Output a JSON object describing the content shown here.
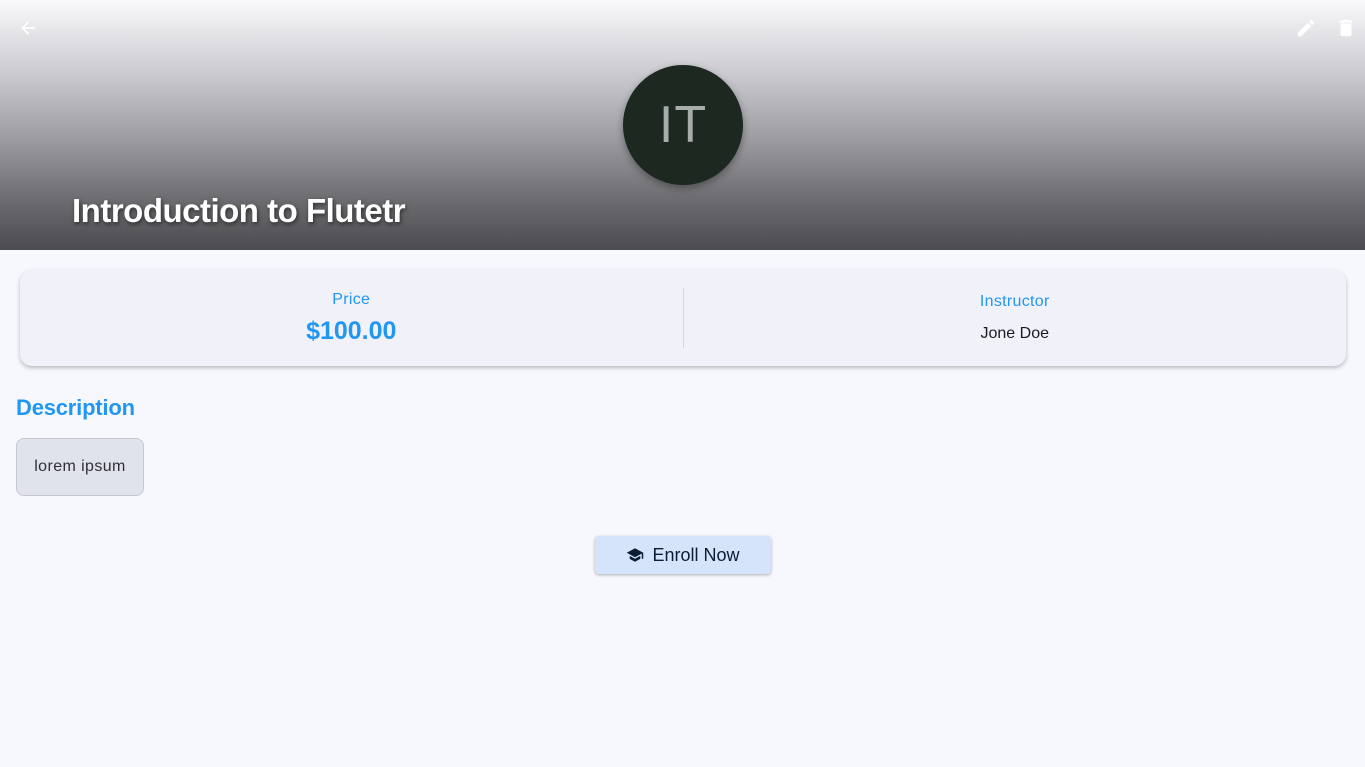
{
  "header": {
    "avatar_initials": "IT",
    "title": "Introduction to Flutetr",
    "icons": {
      "back": "arrow-back-icon",
      "edit": "edit-pencil-icon",
      "delete": "trash-icon"
    },
    "gradient_colors": [
      "#fafafc",
      "#4c4c50"
    ],
    "avatar_color": "#1c2820"
  },
  "info": {
    "price_label": "Price",
    "price_value": "$100.00",
    "instructor_label": "Instructor",
    "instructor_value": "Jone Doe"
  },
  "description": {
    "heading": "Description",
    "text": "lorem ipsum"
  },
  "actions": {
    "enroll_label": "Enroll Now",
    "enroll_icon": "graduation-cap-icon"
  },
  "colors": {
    "accent": "#2196f3",
    "background": "#f7f8fd",
    "card": "#f1f2f9",
    "button_bg": "#d6e4fb"
  }
}
